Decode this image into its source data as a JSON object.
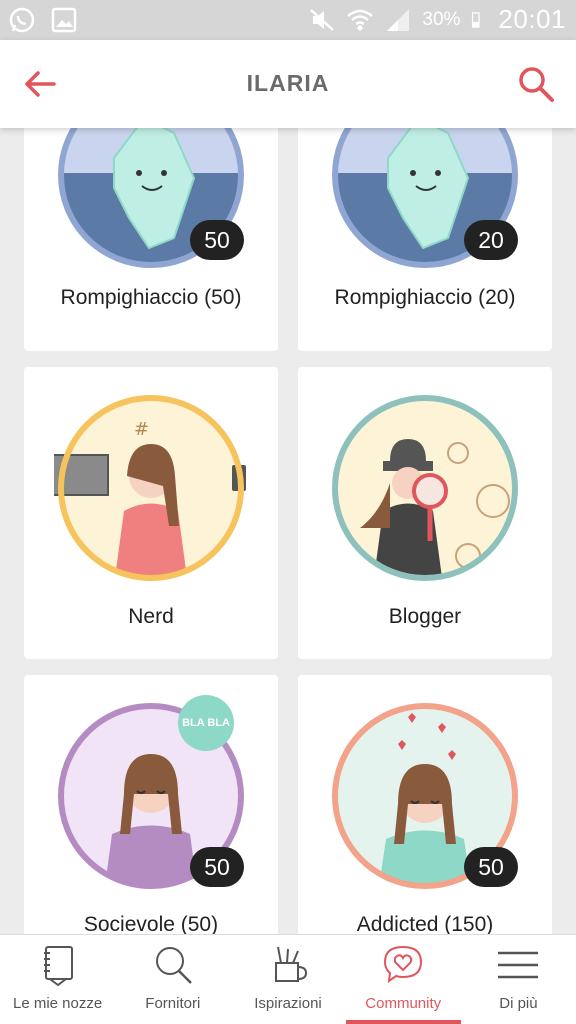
{
  "status_bar": {
    "battery": "30%",
    "time": "20:01",
    "left_icons": [
      "whatsapp-icon",
      "gallery-icon"
    ],
    "right_icons": [
      "mute-icon",
      "wifi-icon",
      "signal-icon",
      "battery-icon"
    ]
  },
  "header": {
    "title": "ILARIA",
    "back_icon": "back-arrow-icon",
    "search_icon": "search-icon"
  },
  "badges": [
    {
      "label": "Rompighiaccio (50)",
      "count": "50",
      "art": "iceberg"
    },
    {
      "label": "Rompighiaccio (20)",
      "count": "20",
      "art": "iceberg"
    },
    {
      "label": "Nerd",
      "count": "",
      "art": "nerd"
    },
    {
      "label": "Blogger",
      "count": "",
      "art": "blogger"
    },
    {
      "label": "Socievole (50)",
      "count": "50",
      "art": "socievole",
      "bubble_text": "BLA BLA"
    },
    {
      "label": "Addicted (150)",
      "count": "50",
      "art": "addicted"
    }
  ],
  "bottom_nav": {
    "items": [
      {
        "label": "Le mie nozze",
        "icon": "notebook-icon"
      },
      {
        "label": "Fornitori",
        "icon": "search-icon"
      },
      {
        "label": "Ispirazioni",
        "icon": "pencil-cup-icon"
      },
      {
        "label": "Community",
        "icon": "heart-bubble-icon"
      },
      {
        "label": "Di più",
        "icon": "menu-icon"
      }
    ],
    "active": "Community"
  },
  "colors": {
    "accent": "#e0565c",
    "iceberg_ring": "#8fa6d2",
    "nerd_ring": "#f6c35d",
    "blogger_ring": "#8fc1bc",
    "socievole_ring": "#b48cc2",
    "addicted_ring": "#f2a38a"
  }
}
